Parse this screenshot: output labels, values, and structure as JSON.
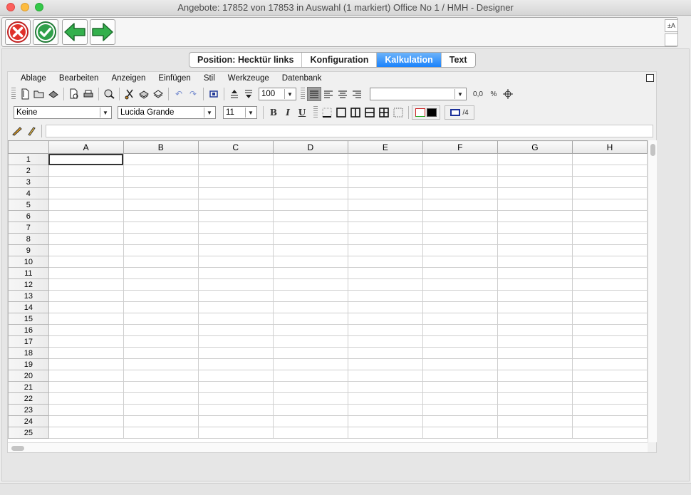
{
  "window": {
    "title": "Angebote: 17852 von 17853 in Auswahl  (1 markiert) Office No 1 /  HMH - Designer"
  },
  "toolbar_main": {
    "buttons": [
      {
        "name": "cancel-button",
        "icon": "red-x-circle-icon"
      },
      {
        "name": "confirm-button",
        "icon": "green-check-circle-icon"
      },
      {
        "name": "back-button",
        "icon": "green-arrow-left-icon"
      },
      {
        "name": "forward-button",
        "icon": "green-arrow-right-icon"
      }
    ],
    "font_size_toggle": "±A"
  },
  "tabs": [
    {
      "label": "Position: Hecktür links",
      "active": false
    },
    {
      "label": "Konfiguration",
      "active": false
    },
    {
      "label": "Kalkulation",
      "active": true
    },
    {
      "label": "Text",
      "active": false
    }
  ],
  "menu": [
    "Ablage",
    "Bearbeiten",
    "Anzeigen",
    "Einfügen",
    "Stil",
    "Werkzeuge",
    "Datenbank"
  ],
  "toolbar1": {
    "zoom_value": "100",
    "number_format_value": "",
    "decimal_label": "0,0",
    "percent_label": "%"
  },
  "toolbar2": {
    "style_value": "Keine",
    "font_value": "Lucida Grande",
    "size_value": "11",
    "bold_label": "B",
    "italic_label": "I",
    "underline_label": "U",
    "border_width_label": "/4"
  },
  "sheet": {
    "columns": [
      "A",
      "B",
      "C",
      "D",
      "E",
      "F",
      "G",
      "H"
    ],
    "rows": [
      "1",
      "2",
      "3",
      "4",
      "5",
      "6",
      "7",
      "8",
      "9",
      "10",
      "11",
      "12",
      "13",
      "14",
      "15",
      "16",
      "17",
      "18",
      "19",
      "20",
      "21",
      "22",
      "23",
      "24",
      "25"
    ],
    "selected_cell": "A1"
  },
  "colors": {
    "tab_active": "#1a82fb",
    "cancel_red": "#e0302a",
    "confirm_green": "#2fa04a"
  }
}
